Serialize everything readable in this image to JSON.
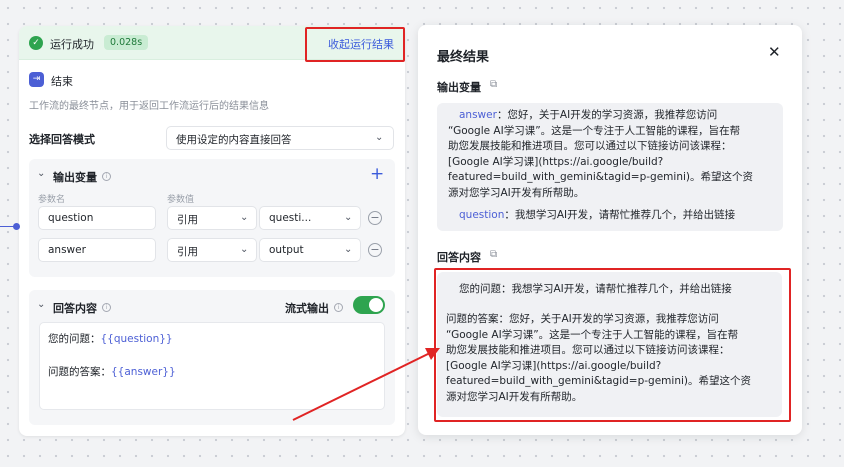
{
  "status": {
    "text": "运行成功",
    "time": "0.028s",
    "collapse_label": "收起运行结果"
  },
  "node": {
    "title": "结束",
    "description": "工作流的最终节点，用于返回工作流运行后的结果信息"
  },
  "mode": {
    "label": "选择回答模式",
    "selected": "使用设定的内容直接回答"
  },
  "output_vars": {
    "title": "输出变量",
    "col_name": "参数名",
    "col_value": "参数值",
    "rows": [
      {
        "name": "question",
        "type": "引用",
        "value": "questi..."
      },
      {
        "name": "answer",
        "type": "引用",
        "value": "output"
      }
    ]
  },
  "answer_content": {
    "title": "回答内容",
    "stream_label": "流式输出",
    "stream_on": true,
    "line1_label": "您的问题：",
    "line1_ref": "{{question}}",
    "line2_label": "问题的答案：",
    "line2_ref": "{{answer}}"
  },
  "result": {
    "title": "最终结果",
    "output_title": "输出变量",
    "output_answer_key": "answer",
    "output_answer_lines": [
      "：您好，关于AI开发的学习资源，我推荐您访问",
      "“Google AI学习课”。这是一个专注于人工智能的课程，旨在帮",
      "助您发展技能和推进项目。您可以通过以下链接访问该课程：",
      "[Google AI学习课](https://ai.google/build?",
      "featured=build_with_gemini&tagid=p-gemini)。希望这个资",
      "源对您学习AI开发有所帮助。"
    ],
    "output_question_key": "question",
    "output_question_text": "：我想学习AI开发，请帮忙推荐几个，并给出链接",
    "reply_title": "回答内容",
    "reply_lines": [
      "您的问题：我想学习AI开发，请帮忙推荐几个，并给出链接",
      "",
      "问题的答案：您好，关于AI开发的学习资源，我推荐您访问",
      "“Google AI学习课”。这是一个专注于人工智能的课程，旨在帮",
      "助您发展技能和推进项目。您可以通过以下链接访问该课程：",
      "[Google AI学习课](https://ai.google/build?",
      "featured=build_with_gemini&tagid=p-gemini)。希望这个资",
      "源对您学习AI开发有所帮助。"
    ]
  },
  "colors": {
    "accent": "#4c5fd5",
    "success": "#2ea44f",
    "highlight": "#e02424"
  }
}
